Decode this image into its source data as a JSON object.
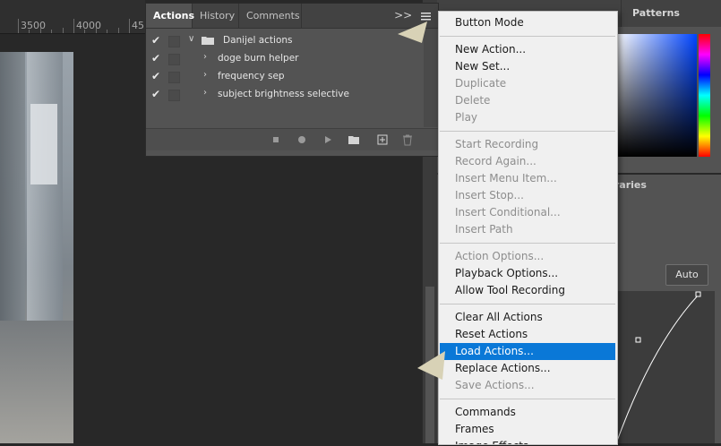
{
  "ruler": {
    "labels": [
      "3500",
      "4000",
      "45"
    ]
  },
  "actions_panel": {
    "tabs": [
      {
        "label": "Actions",
        "active": true
      },
      {
        "label": "History",
        "active": false
      },
      {
        "label": "Comments",
        "active": false
      }
    ],
    "flyout_glyph": ">>",
    "rows": [
      {
        "label": "Danijel actions",
        "type": "set",
        "expanded": true,
        "checked": true
      },
      {
        "label": "doge burn helper",
        "type": "action",
        "expanded": false,
        "checked": true
      },
      {
        "label": "frequency sep",
        "type": "action",
        "expanded": false,
        "checked": true
      },
      {
        "label": "subject brightness selective",
        "type": "action",
        "expanded": false,
        "checked": true
      }
    ],
    "bottom_icons": [
      "stop-icon",
      "record-icon",
      "play-icon",
      "folder-icon",
      "new-action-icon",
      "trash-icon"
    ]
  },
  "right_panels": {
    "patterns_tab": "Patterns",
    "libraries_tab": "braries",
    "auto_button": "Auto"
  },
  "menu": {
    "groups": [
      [
        {
          "label": "Button Mode",
          "enabled": true
        }
      ],
      [
        {
          "label": "New Action...",
          "enabled": true
        },
        {
          "label": "New Set...",
          "enabled": true
        },
        {
          "label": "Duplicate",
          "enabled": false
        },
        {
          "label": "Delete",
          "enabled": false
        },
        {
          "label": "Play",
          "enabled": false
        }
      ],
      [
        {
          "label": "Start Recording",
          "enabled": false
        },
        {
          "label": "Record Again...",
          "enabled": false
        },
        {
          "label": "Insert Menu Item...",
          "enabled": false
        },
        {
          "label": "Insert Stop...",
          "enabled": false
        },
        {
          "label": "Insert Conditional...",
          "enabled": false
        },
        {
          "label": "Insert Path",
          "enabled": false
        }
      ],
      [
        {
          "label": "Action Options...",
          "enabled": false
        },
        {
          "label": "Playback Options...",
          "enabled": true
        },
        {
          "label": "Allow Tool Recording",
          "enabled": true
        }
      ],
      [
        {
          "label": "Clear All Actions",
          "enabled": true
        },
        {
          "label": "Reset Actions",
          "enabled": true
        },
        {
          "label": "Load Actions...",
          "enabled": true,
          "highlighted": true
        },
        {
          "label": "Replace Actions...",
          "enabled": true
        },
        {
          "label": "Save Actions...",
          "enabled": false
        }
      ],
      [
        {
          "label": "Commands",
          "enabled": true
        },
        {
          "label": "Frames",
          "enabled": true
        },
        {
          "label": "Image Effects",
          "enabled": true
        }
      ]
    ]
  },
  "colors": {
    "highlight": "#0a78d7",
    "menu_bg": "#f0f0f0",
    "panel_bg": "#535353",
    "pointer": "#d8d2b6"
  }
}
